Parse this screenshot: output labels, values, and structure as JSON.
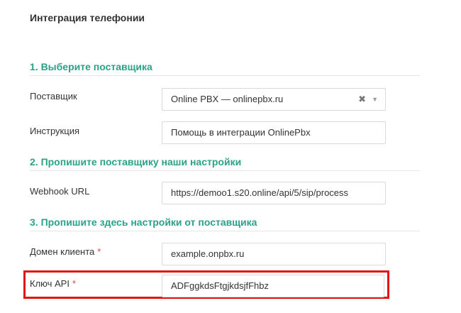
{
  "page": {
    "title": "Интеграция телефонии"
  },
  "sections": [
    {
      "title": "1. Выберите поставщика"
    },
    {
      "title": "2. Пропишите поставщику наши настройки"
    },
    {
      "title": "3. Пропишите здесь настройки от поставщика"
    }
  ],
  "fields": {
    "provider": {
      "label": "Поставщик",
      "value": "Online PBX — onlinepbx.ru",
      "clear_icon": "clear-icon",
      "arrow_icon": "chevron-down-icon"
    },
    "instruction": {
      "label": "Инструкция",
      "value": "Помощь в интеграции OnlinePbx"
    },
    "webhook": {
      "label": "Webhook URL",
      "value": "https://demoo1.s20.online/api/5/sip/process"
    },
    "domain": {
      "label": "Домен клиента",
      "required": "*",
      "value": "example.onpbx.ru"
    },
    "api_key": {
      "label": "Ключ API",
      "required": "*",
      "value": "ADFggkdsFtgjkdsjfFhbz"
    }
  },
  "colors": {
    "section_accent": "#2aa189",
    "required": "#e04545",
    "highlight": "#e31414"
  }
}
